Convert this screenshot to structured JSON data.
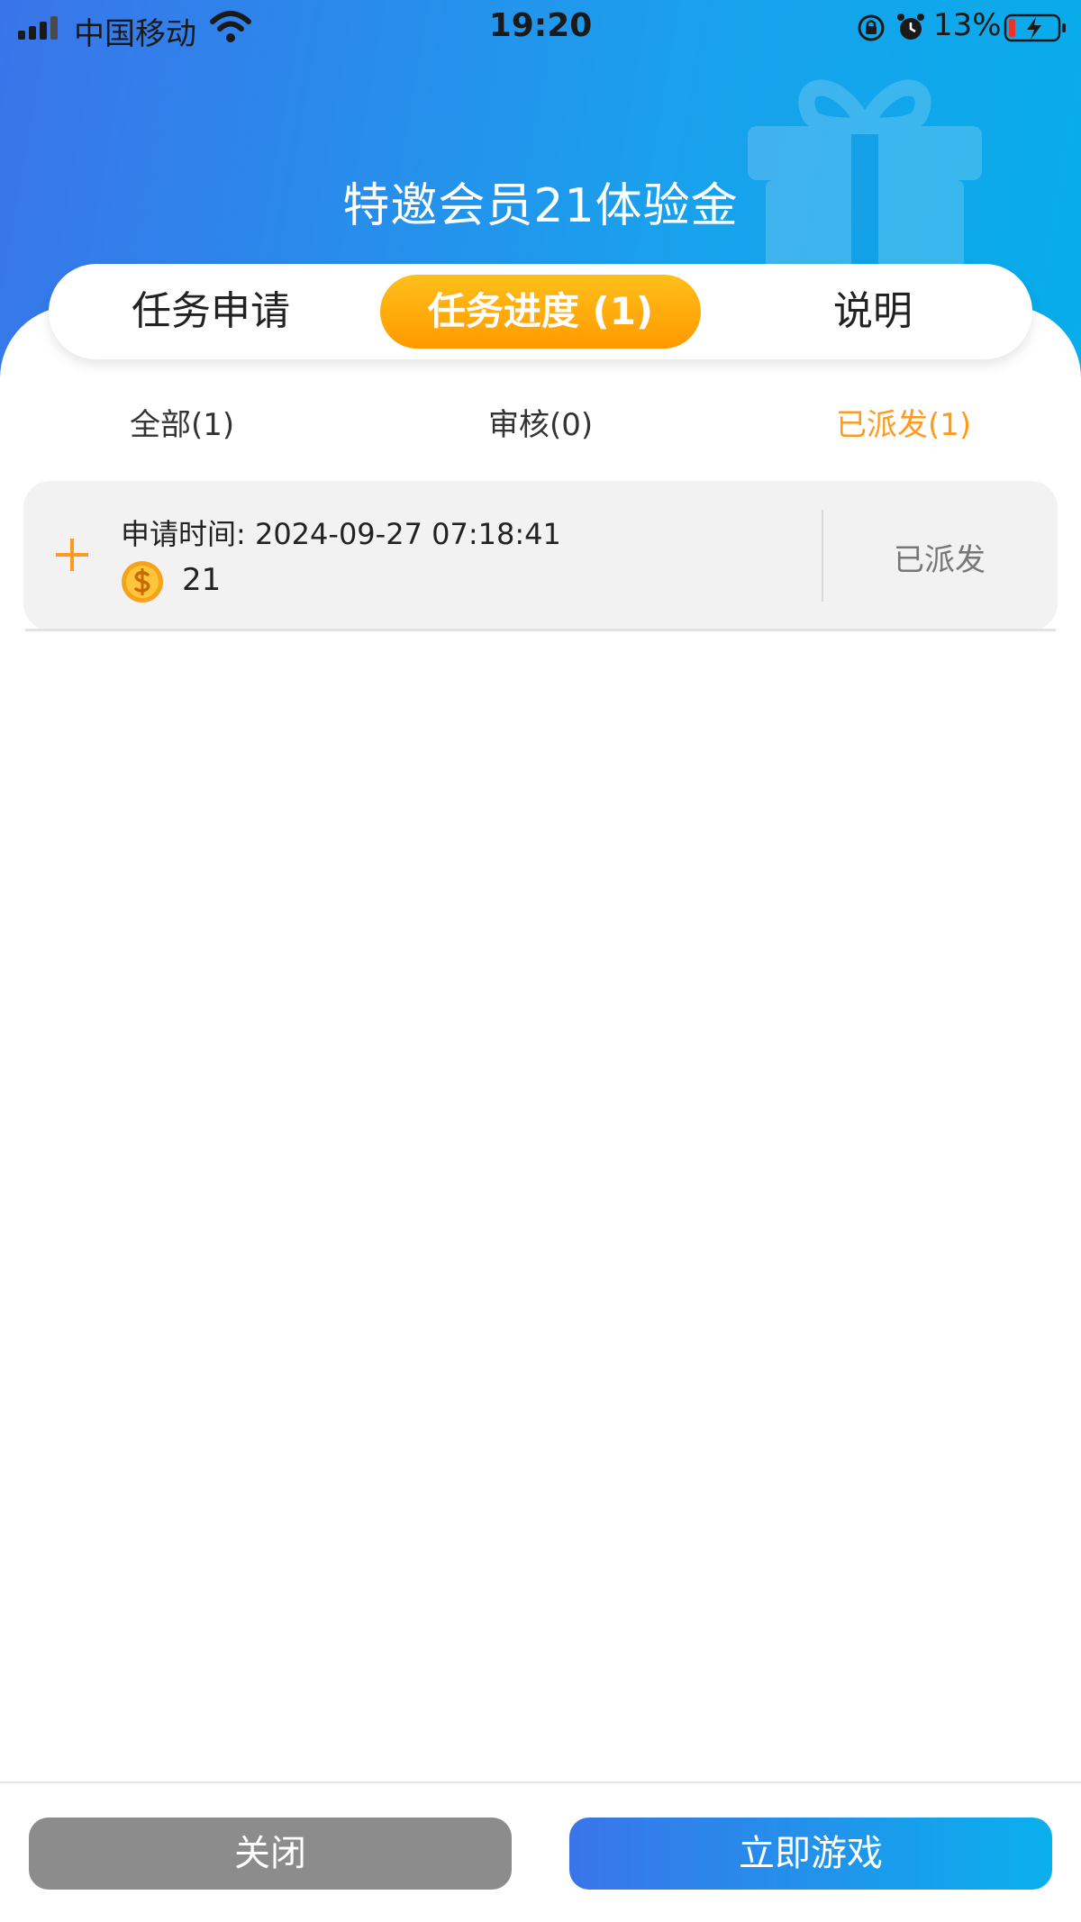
{
  "status_bar": {
    "carrier": "中国移动",
    "time": "19:20",
    "battery_percent": "13%",
    "battery_level": 0.13,
    "icons": [
      "signal-icon",
      "wifi-icon",
      "orientation-lock-icon",
      "alarm-icon",
      "battery-charging-icon"
    ]
  },
  "header": {
    "title": "特邀会员21体验金",
    "decoration_icon": "gift-icon"
  },
  "tabs": [
    {
      "label": "任务申请",
      "active": false
    },
    {
      "label": "任务进度 (1)",
      "active": true
    },
    {
      "label": "说明",
      "active": false
    }
  ],
  "filters": [
    {
      "label": "全部(1)",
      "active": false
    },
    {
      "label": "审核(0)",
      "active": false
    },
    {
      "label": "已派发(1)",
      "active": true
    }
  ],
  "records": [
    {
      "apply_time": "申请时间: 2024-09-27 07:18:41",
      "amount": "21",
      "status": "已派发",
      "icons": [
        "plus-icon",
        "coin-icon"
      ]
    }
  ],
  "footer": {
    "close_label": "关闭",
    "play_label": "立即游戏"
  },
  "colors": {
    "header_gradient_start": "#3a74ea",
    "header_gradient_end": "#07adeb",
    "accent_orange": "#ff9a00",
    "close_button": "#8c8c8c"
  }
}
